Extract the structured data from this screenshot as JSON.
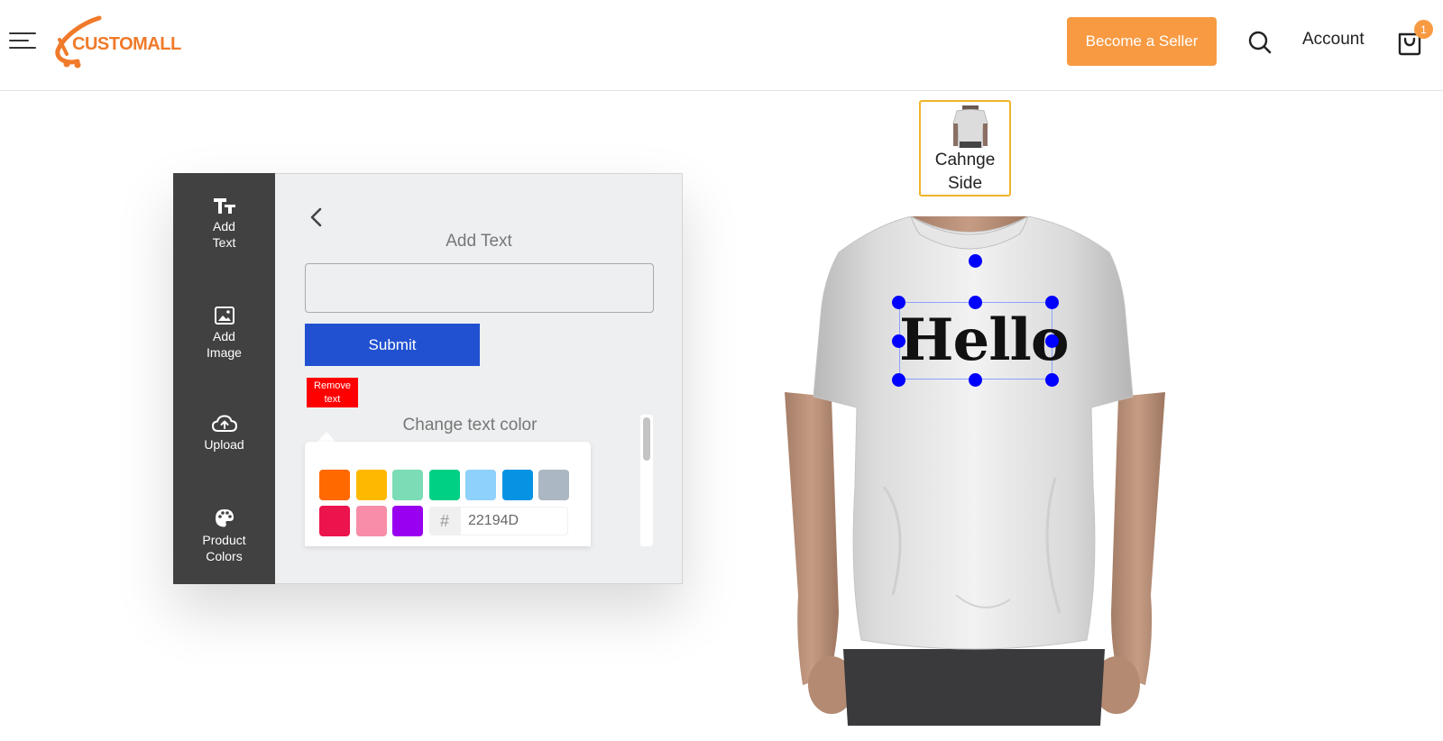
{
  "header": {
    "logo_text": "CUSTOMALL",
    "seller_button": "Become a Seller",
    "account_label": "Account",
    "cart_count": "1",
    "brand_color": "#f07a2a",
    "button_color": "#f89a42"
  },
  "sidebar": {
    "items": [
      {
        "label_line1": "Add",
        "label_line2": "Text",
        "icon": "text-size-icon"
      },
      {
        "label_line1": "Add",
        "label_line2": "Image",
        "icon": "image-icon"
      },
      {
        "label_line1": "Upload",
        "label_line2": "",
        "icon": "cloud-upload-icon"
      },
      {
        "label_line1": "Product",
        "label_line2": "Colors",
        "icon": "palette-icon"
      }
    ]
  },
  "editor": {
    "title": "Add Text",
    "input_value": "",
    "submit_label": "Submit",
    "remove_label_line1": "Remove",
    "remove_label_line2": "text",
    "color_title": "Change text color",
    "swatches": [
      "#ff6900",
      "#fcb900",
      "#7bdcb5",
      "#00d084",
      "#8ed1fc",
      "#0693e3",
      "#abb8c3",
      "#eb144c",
      "#f78da7",
      "#9900ef"
    ],
    "hash_symbol": "#",
    "hex_value": "22194D",
    "submit_color": "#2151d1",
    "remove_color": "#ff0000"
  },
  "preview": {
    "change_side_line1": "Cahnge",
    "change_side_line2": "Side",
    "design_text": "Hello",
    "handle_color": "#0000ff"
  }
}
